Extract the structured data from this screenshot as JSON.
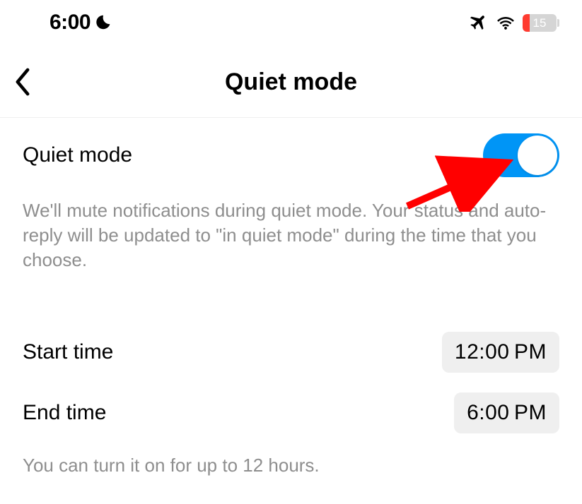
{
  "status": {
    "time": "6:00",
    "battery_percent": "15"
  },
  "header": {
    "title": "Quiet mode"
  },
  "main": {
    "toggle_label": "Quiet mode",
    "toggle_on": true,
    "description": "We'll mute notifications during quiet mode. Your status and auto-reply will be updated to \"in quiet mode\" during the time that you choose.",
    "start_label": "Start time",
    "start_value": "12:00 PM",
    "end_label": "End time",
    "end_value": "6:00 PM",
    "footnote": "You can turn it on for up to 12 hours."
  },
  "colors": {
    "accent": "#0095f6",
    "battery_low": "#ff3b30",
    "arrow": "#ff0000",
    "muted": "#8e8e8e",
    "pill_bg": "#efefef"
  }
}
